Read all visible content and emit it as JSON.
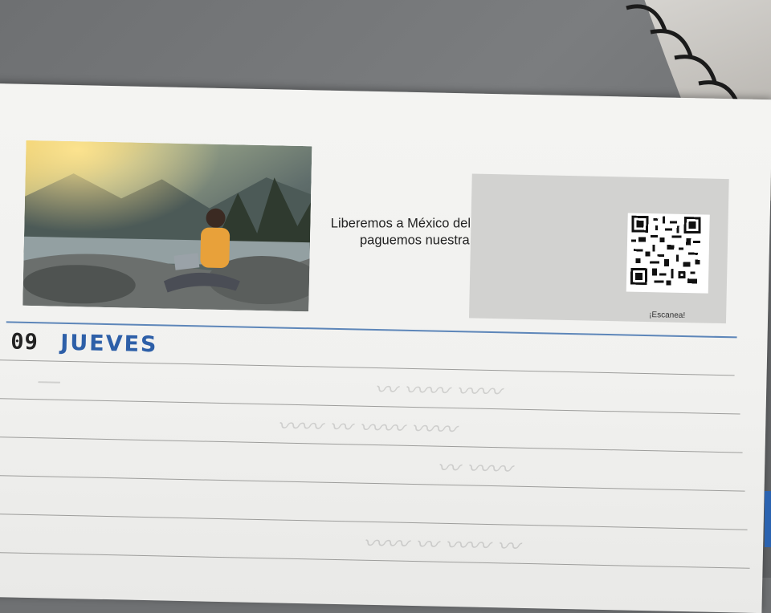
{
  "planner_page": {
    "promo": {
      "text": "Liberemos a México del calentamiento social, paguemos nuestra Hipoteca Social.",
      "scan_label": "¡Escanea!"
    },
    "day": {
      "number": "09",
      "name": "JUEVES"
    },
    "photo": {
      "subject": "person-with-laptop-by-river"
    }
  },
  "colors": {
    "day_name": "#2d5fa8",
    "day_rule": "#5d86b9",
    "paper": "#f2f2f0",
    "desk": "#6f7173"
  }
}
